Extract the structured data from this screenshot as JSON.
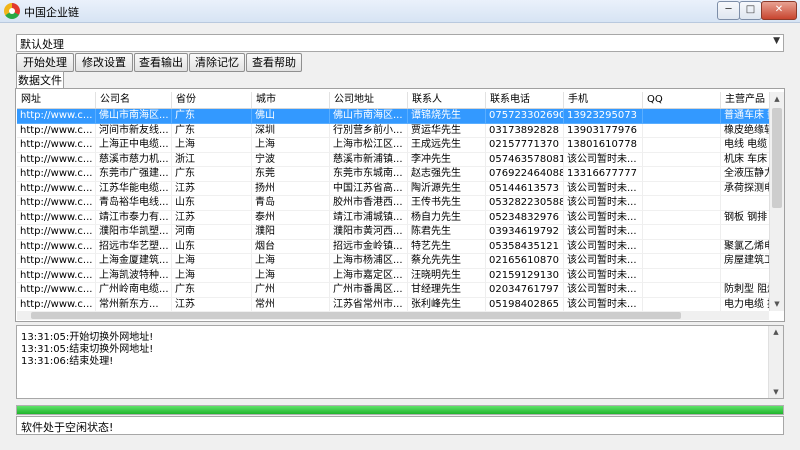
{
  "window": {
    "title": "中国企业链",
    "min": "─",
    "max": "□",
    "close": "✕"
  },
  "mode_select": {
    "value": "默认处理",
    "arrow": "▼"
  },
  "toolbar": [
    "开始处理",
    "修改设置",
    "查看输出",
    "清除记忆",
    "查看帮助"
  ],
  "tab": {
    "label": "数据文件"
  },
  "table": {
    "columns": [
      "网址",
      "公司名",
      "省份",
      "城市",
      "公司地址",
      "联系人",
      "联系电话",
      "手机",
      "QQ",
      "主营产品"
    ],
    "rows": [
      [
        "http://www.c...",
        "佛山市南海区...",
        "广东",
        "佛山",
        "佛山市南海区...",
        "谭锦烧先生",
        "075723302690",
        "13923295073",
        "",
        "普通车床 数"
      ],
      [
        "http://www.c...",
        "河间市新友线...",
        "广东",
        "深圳",
        "行別营乡前小...",
        "贾运华先生",
        "03173892828",
        "13903177976",
        "",
        "橡皮绝缘软"
      ],
      [
        "http://www.c...",
        "上海正中电缆...",
        "上海",
        "上海",
        "上海市松江区...",
        "王成远先生",
        "02157771370",
        "13801610778",
        "",
        "电线 电缆"
      ],
      [
        "http://www.c...",
        "慈溪市慈力机...",
        "浙江",
        "宁波",
        "慈溪市新浦镇...",
        "李冲先生",
        "057463578081",
        "该公司暂时未...",
        "",
        "机床 车床"
      ],
      [
        "http://www.c...",
        "东莞市广强建...",
        "广东",
        "东莞",
        "东莞市东城南...",
        "赵志强先生",
        "076922464088",
        "13316677777",
        "",
        "全液压静力"
      ],
      [
        "http://www.c...",
        "江苏华能电缆...",
        "江苏",
        "扬州",
        "中国江苏省高...",
        "陶沂源先生",
        "05144613573",
        "该公司暂时未...",
        "",
        "承荷探测电"
      ],
      [
        "http://www.c...",
        "青岛裕华电线...",
        "山东",
        "青岛",
        "胶州市香港西...",
        "王传书先生",
        "053282230588",
        "该公司暂时未...",
        "",
        ""
      ],
      [
        "http://www.c...",
        "靖江市泰力有...",
        "江苏",
        "泰州",
        "靖江市浦城镇...",
        "杨自力先生",
        "05234832976",
        "该公司暂时未...",
        "",
        "钢板 钢排"
      ],
      [
        "http://www.c...",
        "濮阳市华凯塑...",
        "河南",
        "濮阳",
        "濮阳市黄河西...",
        "陈君先生",
        "03934619792",
        "该公司暂时未...",
        "",
        ""
      ],
      [
        "http://www.c...",
        "招远市华艺塑...",
        "山东",
        "烟台",
        "招远市金岭镇...",
        "特艺先生",
        "05358435121",
        "该公司暂时未...",
        "",
        "聚氯乙烯电"
      ],
      [
        "http://www.c...",
        "上海金厦建筑...",
        "上海",
        "上海",
        "上海市杨浦区...",
        "蔡允先先生",
        "02165610870",
        "该公司暂时未...",
        "",
        "房屋建筑工"
      ],
      [
        "http://www.c...",
        "上海凯波特种...",
        "上海",
        "上海",
        "上海市嘉定区...",
        "汪晓明先生",
        "02159129130",
        "该公司暂时未...",
        "",
        ""
      ],
      [
        "http://www.c...",
        "广州岭南电缆...",
        "广东",
        "广州",
        "广州市番禺区...",
        "甘经理先生",
        "02034761797",
        "该公司暂时未...",
        "",
        "防刺型 阻燃"
      ],
      [
        "http://www.c...",
        "常州新东方...",
        "江苏",
        "常州",
        "江苏省常州市...",
        "张利峰先生",
        "05198402865",
        "该公司暂时未...",
        "",
        "电力电缆 控"
      ]
    ],
    "selected_row": 0
  },
  "log": [
    "13:31:05:开始切换外网地址!",
    "13:31:05:结束切换外网地址!",
    "13:31:06:结束处理!"
  ],
  "progress": {
    "percent": 100,
    "color": "#22b42f"
  },
  "status": {
    "text": "软件处于空闲状态!"
  }
}
